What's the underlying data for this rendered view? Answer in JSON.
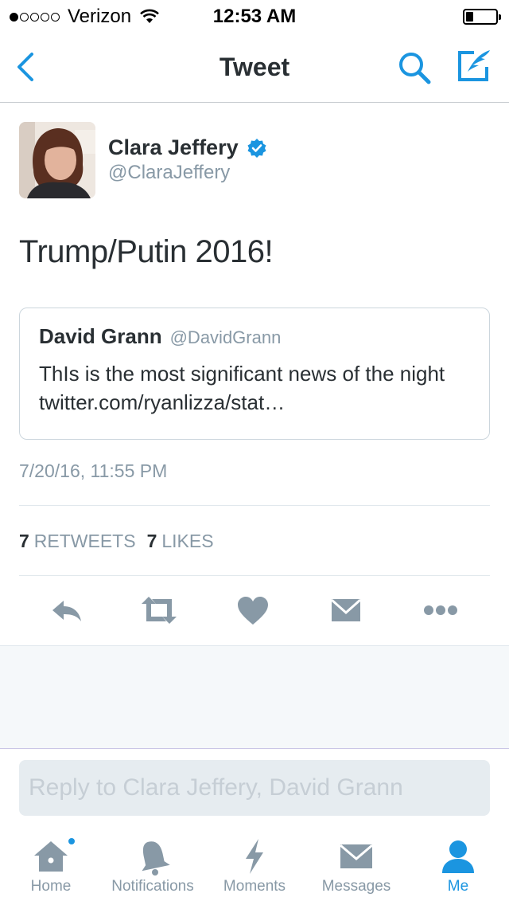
{
  "status_bar": {
    "carrier": "Verizon",
    "time": "12:53 AM",
    "signal_bars": 1,
    "battery_level": 0.2
  },
  "nav": {
    "title": "Tweet"
  },
  "tweet": {
    "author_name": "Clara Jeffery",
    "author_handle": "@ClaraJeffery",
    "verified": true,
    "text": "Trump/Putin 2016!",
    "timestamp": "7/20/16, 11:55 PM",
    "retweets_count": "7",
    "retweets_label": "RETWEETS",
    "likes_count": "7",
    "likes_label": "LIKES"
  },
  "quoted_tweet": {
    "author_name": "David Grann",
    "author_handle": "@DavidGrann",
    "text": "ThIs is the most significant news of the night twitter.com/ryanlizza/stat…"
  },
  "reply": {
    "placeholder": "Reply to Clara Jeffery, David Grann"
  },
  "tabs": [
    {
      "label": "Home",
      "icon": "home-icon",
      "has_dot": true
    },
    {
      "label": "Notifications",
      "icon": "bell-icon"
    },
    {
      "label": "Moments",
      "icon": "lightning-icon"
    },
    {
      "label": "Messages",
      "icon": "envelope-icon"
    },
    {
      "label": "Me",
      "icon": "person-icon",
      "active": true
    }
  ],
  "colors": {
    "accent": "#1b95e0",
    "text": "#292f33",
    "muted": "#8899a6",
    "icon_gray": "#8899a6"
  }
}
